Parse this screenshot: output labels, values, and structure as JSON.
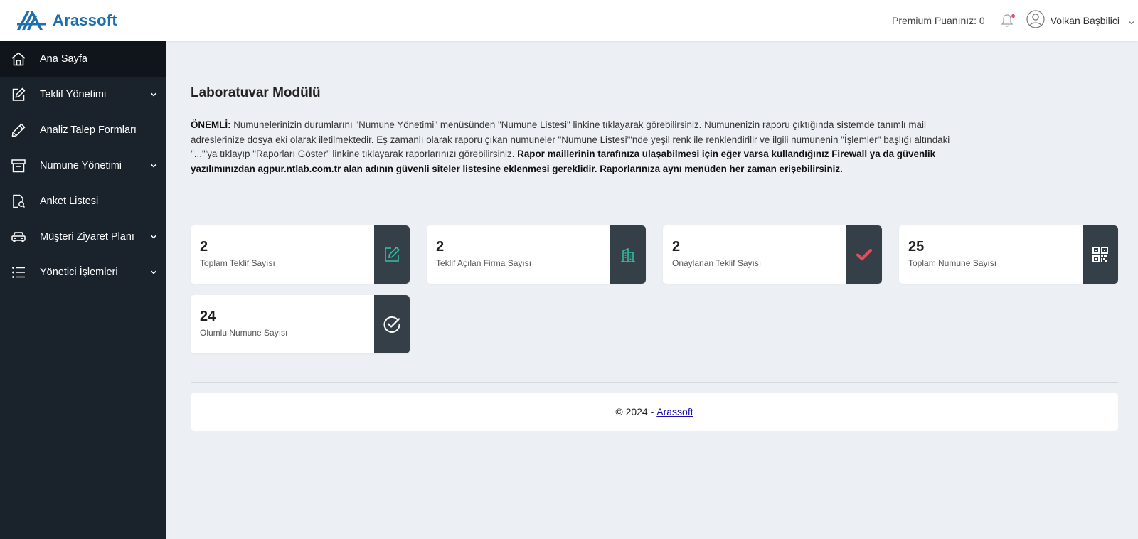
{
  "header": {
    "brand": "Arassoft",
    "premium_label": "Premium Puanınız: 0",
    "user_name": "Volkan Başbilici",
    "notification_dot_color": "#e74c5b"
  },
  "sidebar": {
    "items": [
      {
        "label": "Ana Sayfa",
        "icon": "home-icon",
        "active": true,
        "has_submenu": false
      },
      {
        "label": "Teklif Yönetimi",
        "icon": "edit-icon",
        "active": false,
        "has_submenu": true
      },
      {
        "label": "Analiz Talep Formları",
        "icon": "pencil-icon",
        "active": false,
        "has_submenu": false
      },
      {
        "label": "Numune Yönetimi",
        "icon": "archive-icon",
        "active": false,
        "has_submenu": true
      },
      {
        "label": "Anket Listesi",
        "icon": "survey-icon",
        "active": false,
        "has_submenu": false
      },
      {
        "label": "Müşteri Ziyaret Planı",
        "icon": "car-icon",
        "active": false,
        "has_submenu": true
      },
      {
        "label": "Yönetici İşlemleri",
        "icon": "list-icon",
        "active": false,
        "has_submenu": true
      }
    ]
  },
  "main": {
    "title": "Laboratuvar Modülü",
    "notice": {
      "prefix": "ÖNEMLİ:",
      "text": " Numunelerinizin durumlarını \"Numune Yönetimi\" menüsünden \"Numune Listesi\" linkine tıklayarak görebilirsiniz. Numunenizin raporu çıktığında sistemde tanımlı mail adreslerinize dosya eki olarak iletilmektedir. Eş zamanlı olarak raporu çıkan numuneler \"Numune Listesi\"'nde yeşil renk ile renklendirilir ve ilgili numunenin \"İşlemler\" başlığı altındaki \"...\"'ya tıklayıp \"Raporları Göster\" linkine tıklayarak raporlarınızı görebilirsiniz. ",
      "bold": "Rapor maillerinin tarafınıza ulaşabilmesi için eğer varsa kullandığınız Firewall ya da güvenlik yazılımınızdan agpur.ntlab.com.tr alan adının güvenli siteler listesine eklenmesi gereklidir. Raporlarınıza aynı menüden her zaman erişebilirsiniz."
    },
    "cards": [
      {
        "value": "2",
        "label": "Toplam Teklif Sayısı",
        "icon": "edit-icon",
        "icon_color": "#2ec4a6"
      },
      {
        "value": "2",
        "label": "Teklif Açılan Firma Sayısı",
        "icon": "building-icon",
        "icon_color": "#2ec4a6"
      },
      {
        "value": "2",
        "label": "Onaylanan Teklif Sayısı",
        "icon": "check-icon",
        "icon_color": "#e74c5b"
      },
      {
        "value": "25",
        "label": "Toplam Numune Sayısı",
        "icon": "qr-code-icon",
        "icon_color": "#ffffff"
      },
      {
        "value": "24",
        "label": "Olumlu Numune Sayısı",
        "icon": "check-circle-icon",
        "icon_color": "#ffffff"
      }
    ]
  },
  "footer": {
    "copyright": "© 2024 -",
    "link": "Arassoft"
  }
}
